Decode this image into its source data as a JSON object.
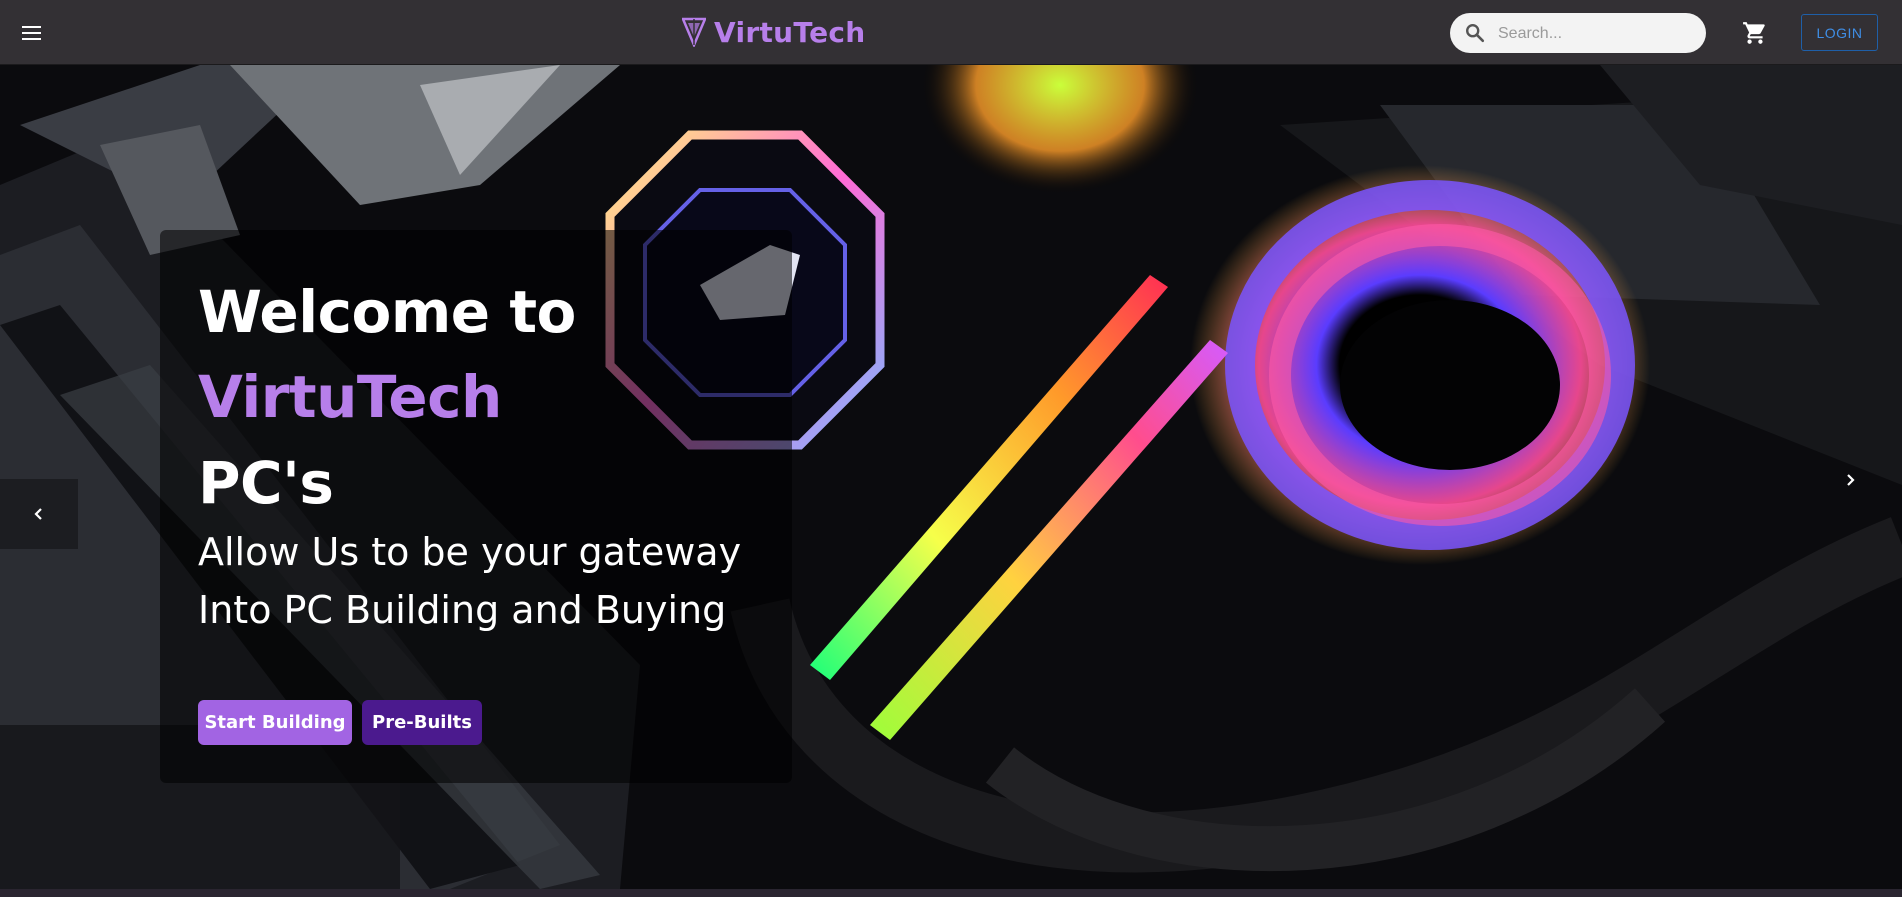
{
  "navbar": {
    "brand_name": "VirtuTech",
    "search_placeholder": "Search...",
    "login_label": "LOGIN"
  },
  "hero": {
    "heading_line1": "Welcome to",
    "heading_line2": "VirtuTech",
    "heading_line3": "PC's",
    "subtitle_line1": "Allow Us to be your gateway",
    "subtitle_line2": "Into PC Building and Buying",
    "primary_button": "Start Building",
    "secondary_button": "Pre-Builts"
  },
  "icons": [
    "menu-icon",
    "brand-logo-icon",
    "search-icon",
    "cart-icon",
    "chevron-left-icon",
    "chevron-right-icon"
  ],
  "colors": {
    "navbar_bg": "#333034",
    "brand_purple": "#b77fea",
    "primary_button": "#a264e3",
    "secondary_button": "#4b1a8e",
    "login_blue": "#3f8ee6"
  }
}
